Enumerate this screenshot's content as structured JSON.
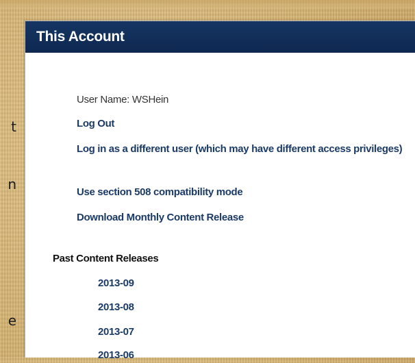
{
  "left_edge_glyphs": [
    "t",
    "n",
    "e"
  ],
  "account": {
    "title": "This Account",
    "user_name": "User Name: WSHein",
    "links": {
      "log_out": "Log Out",
      "different_user": "Log in as a different user (which may have different access privileges)",
      "section_508": "Use section 508 compatibility mode",
      "download_monthly": "Download Monthly Content Release"
    },
    "past_releases_title": "Past Content Releases",
    "past_releases": [
      "2013-09",
      "2013-08",
      "2013-07",
      "2013-06"
    ]
  },
  "colors": {
    "header_bg": "#0f2a52",
    "link": "#1b3a66",
    "background": "#d8b97c"
  }
}
